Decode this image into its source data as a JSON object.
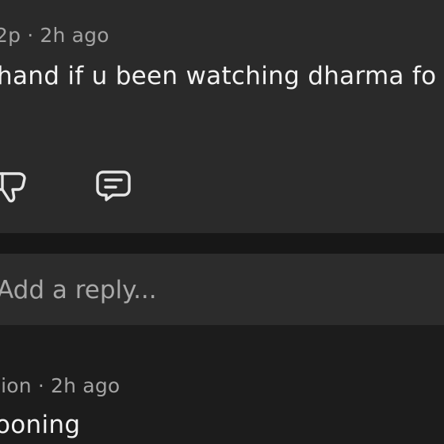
{
  "comment": {
    "author": "2p",
    "separator": "·",
    "time": "2h ago",
    "body": "hand if u been watching dharma fo"
  },
  "actions": {
    "dislike_icon": "thumbs-down-icon",
    "reply_icon": "comment-bubble-icon"
  },
  "reply": {
    "placeholder": "Add a reply..."
  },
  "next_comment": {
    "author": "lion",
    "separator": "·",
    "time": "2h ago",
    "body": "ooning"
  },
  "colors": {
    "card_bg": "#2a2a2a",
    "page_bg": "#1c1c1c",
    "meta_text": "#a3a3a3",
    "body_text": "#f2f2f2"
  }
}
